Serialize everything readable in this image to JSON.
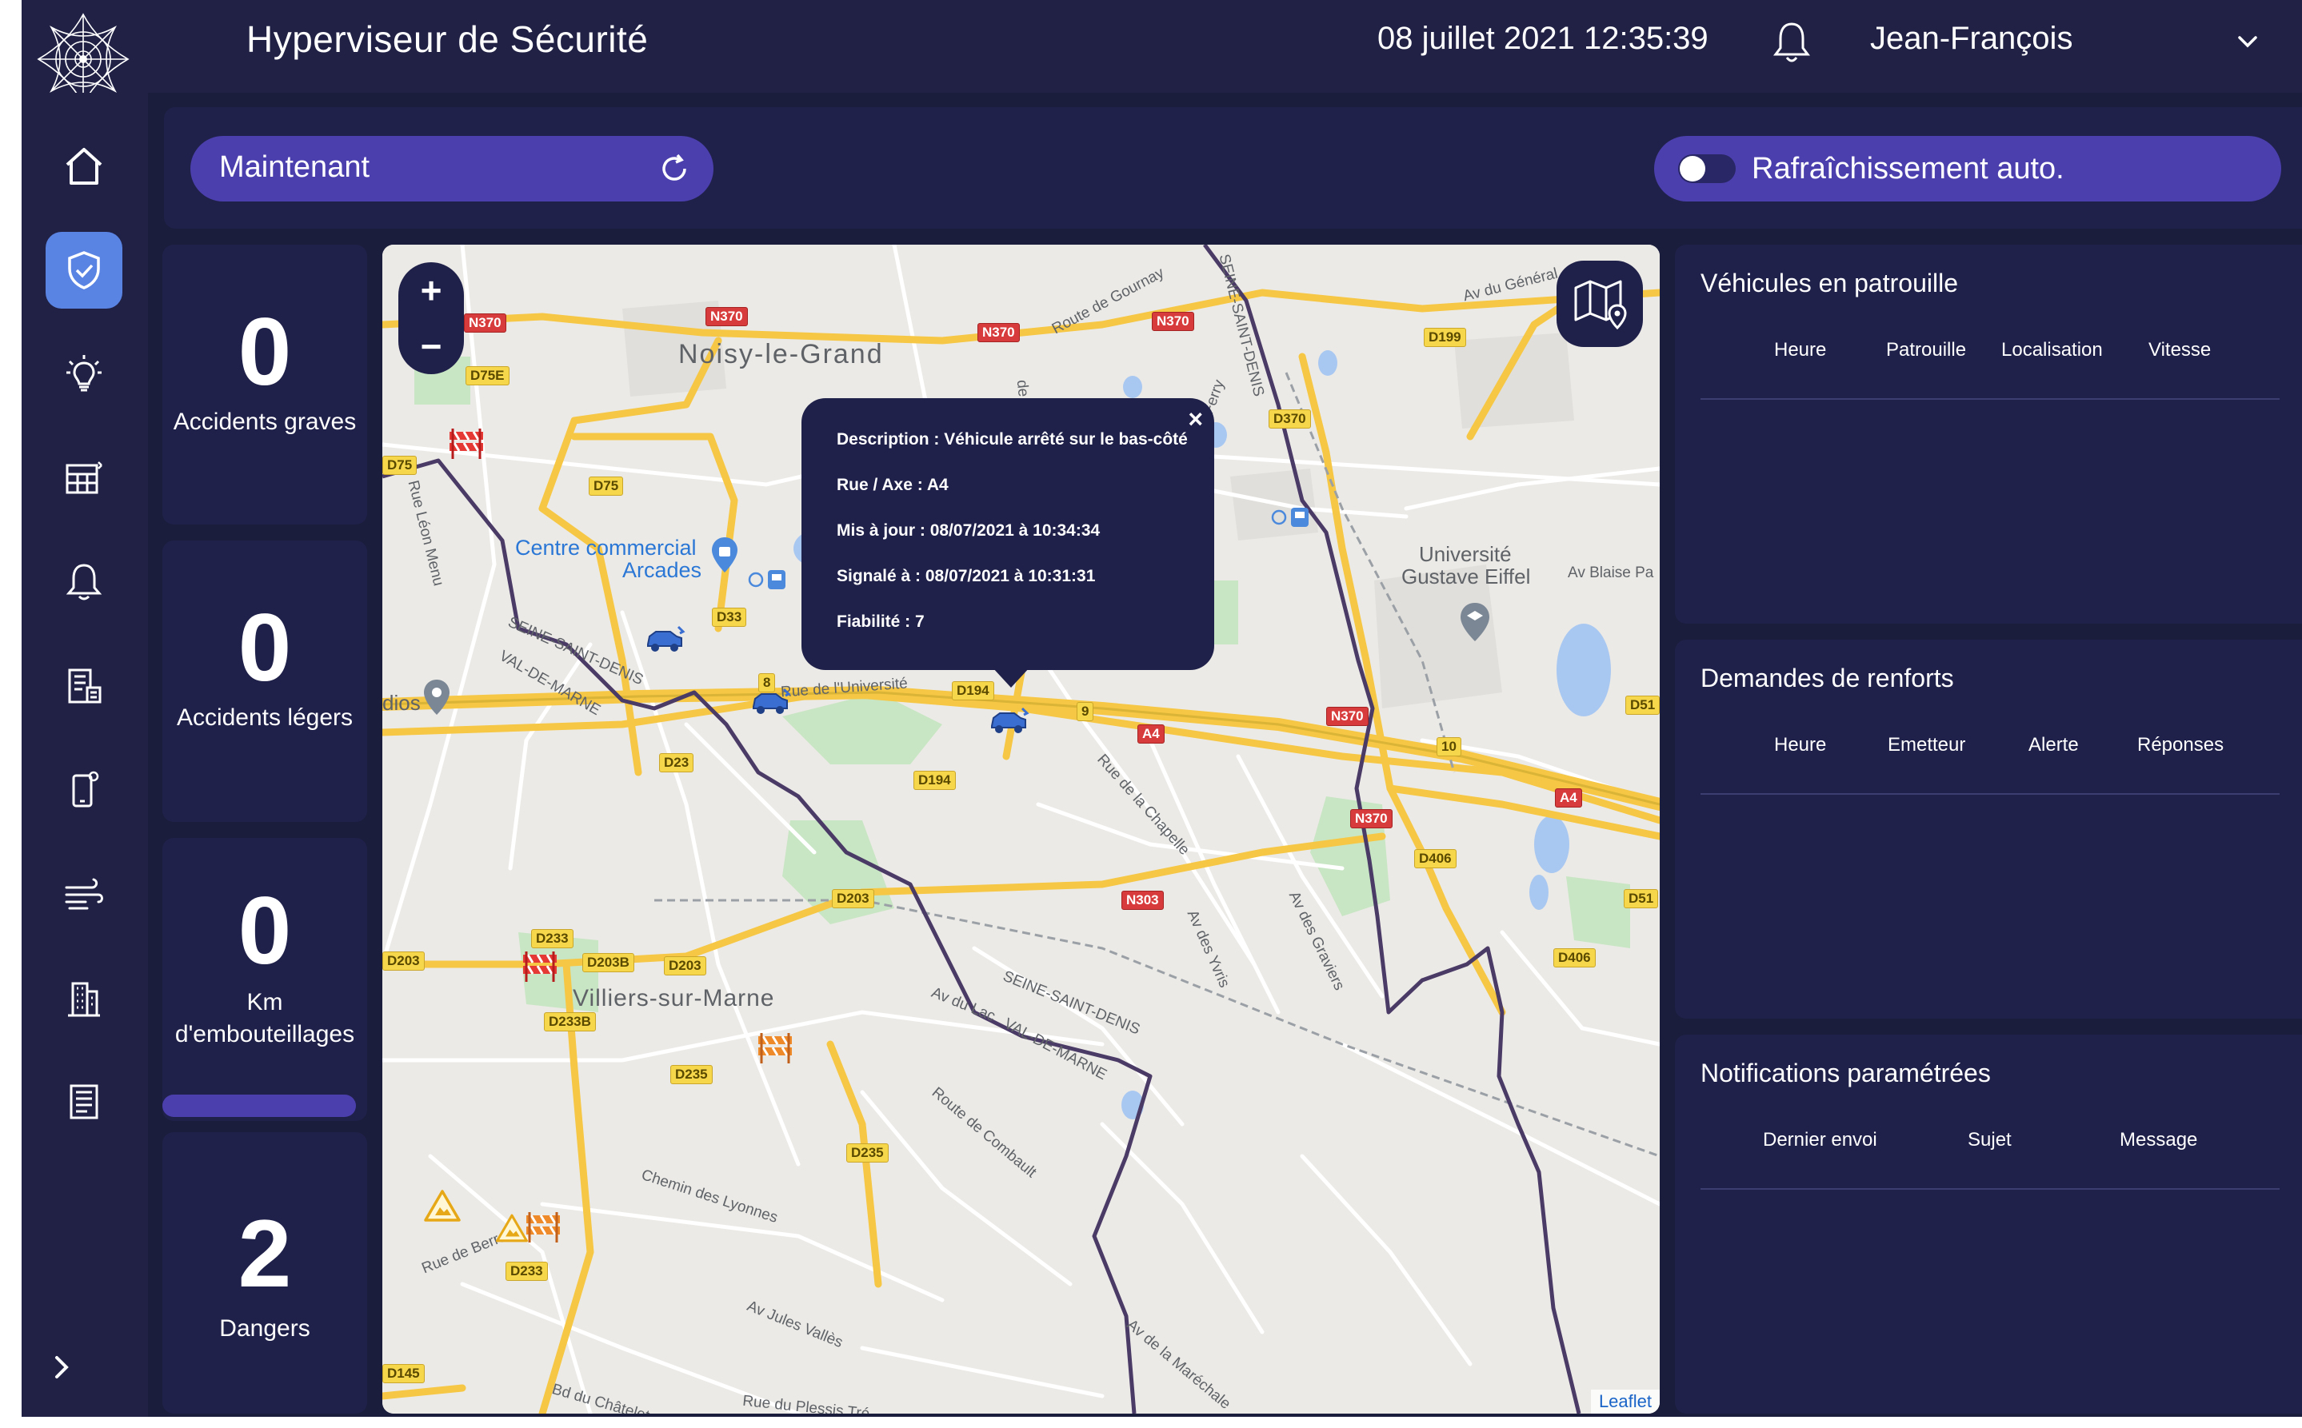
{
  "header": {
    "title": "Hyperviseur de Sécurité",
    "datetime": "08 juillet 2021 12:35:39",
    "user": "Jean-François"
  },
  "sidebar": {
    "items": [
      {
        "name": "home",
        "icon": "home-icon"
      },
      {
        "name": "security",
        "icon": "shield-icon",
        "active": true
      },
      {
        "name": "lighting",
        "icon": "lightbulb-icon"
      },
      {
        "name": "tables",
        "icon": "table-icon"
      },
      {
        "name": "alerts",
        "icon": "bell-icon"
      },
      {
        "name": "reports",
        "icon": "document-icon"
      },
      {
        "name": "mobile",
        "icon": "phone-icon"
      },
      {
        "name": "air",
        "icon": "wind-icon"
      },
      {
        "name": "buildings",
        "icon": "building-icon"
      },
      {
        "name": "journal",
        "icon": "newspaper-icon"
      }
    ]
  },
  "controls": {
    "time_label": "Maintenant",
    "auto_refresh_label": "Rafraîchissement auto.",
    "auto_refresh_on": false
  },
  "stats": [
    {
      "value": "0",
      "label": "Accidents graves"
    },
    {
      "value": "0",
      "label": "Accidents légers"
    },
    {
      "value": "0",
      "label": "Km d'embouteillages"
    },
    {
      "value": "2",
      "label": "Dangers"
    }
  ],
  "map": {
    "zoom_in": "+",
    "zoom_out": "−",
    "attribution": "Leaflet",
    "places": {
      "noisy": "Noisy-le-Grand",
      "arcades": "Centre commercial Arcades",
      "arcades_1": "Centre commercial",
      "arcades_2": "Arcades",
      "universite_1": "Université",
      "universite_2": "Gustave Eiffel",
      "villiers": "Villiers-sur-Marne",
      "ssd1": "SEINE-SAINT-DENIS",
      "vdm1": "VAL-DE-MARNE",
      "ssd2": "SEINE-SAINT-DENIS",
      "vdm2": "VAL-DE-MARNE",
      "ssd3": "SEINE-SAINT-DENIS",
      "dios": "dios"
    },
    "streets": {
      "gournay": "Route de Gournay",
      "general": "Av du Général",
      "blaise": "Av Blaise Pa",
      "ferry": "Ferry",
      "lisle": "de l'Isle",
      "leon": "Rue Léon Menu",
      "universite": "Rue de l'Université",
      "chapelle": "Rue de la Chapelle",
      "yvris": "Av des Yvris",
      "graviers": "Av des Graviers",
      "lac": "Av du Lac",
      "combault": "Route de Combault",
      "lyonnes": "Chemin des Lyonnes",
      "berrau": "Rue de Berrau",
      "jules": "Av Jules Vallès",
      "marechale": "Av de la Maréchale",
      "chatelet": "Bd du Châtelet",
      "plessis": "Rue du Plessis Tré"
    },
    "roads": [
      "N370",
      "N370",
      "N370",
      "N370",
      "D75E",
      "D75",
      "D33",
      "D194",
      "D194",
      "D370",
      "D199",
      "A4",
      "A4",
      "D51",
      "D51",
      "N370",
      "N370",
      "D23",
      "D203",
      "D203",
      "D203B",
      "D203",
      "D233",
      "D233B",
      "D235",
      "D235",
      "D233",
      "D406",
      "D406",
      "N303",
      "D145",
      "D75",
      "9",
      "8",
      "10"
    ],
    "popup": {
      "description_label": "Description :",
      "description": "Véhicule arrêté sur le bas-côté",
      "road_label": "Rue / Axe :",
      "road": "A4",
      "updated_label": "Mis à jour :",
      "updated": "08/07/2021 à 10:34:34",
      "reported_label": "Signalé à :",
      "reported": "08/07/2021 à 10:31:31",
      "reliability_label": "Fiabilité :",
      "reliability": "7"
    }
  },
  "panels": {
    "patrol": {
      "title": "Véhicules en patrouille",
      "columns": [
        "Heure",
        "Patrouille",
        "Localisation",
        "Vitesse"
      ]
    },
    "backup": {
      "title": "Demandes de renforts",
      "columns": [
        "Heure",
        "Emetteur",
        "Alerte",
        "Réponses"
      ]
    },
    "notifications": {
      "title": "Notifications paramétrées",
      "columns": [
        "Dernier envoi",
        "Sujet",
        "Message"
      ]
    }
  },
  "colors": {
    "background": "#1b1d3c",
    "panel": "#20214a",
    "accent": "#4b3fae",
    "active": "#5a84e4",
    "road_major": "#f6c744",
    "border": "#4a3a66"
  }
}
